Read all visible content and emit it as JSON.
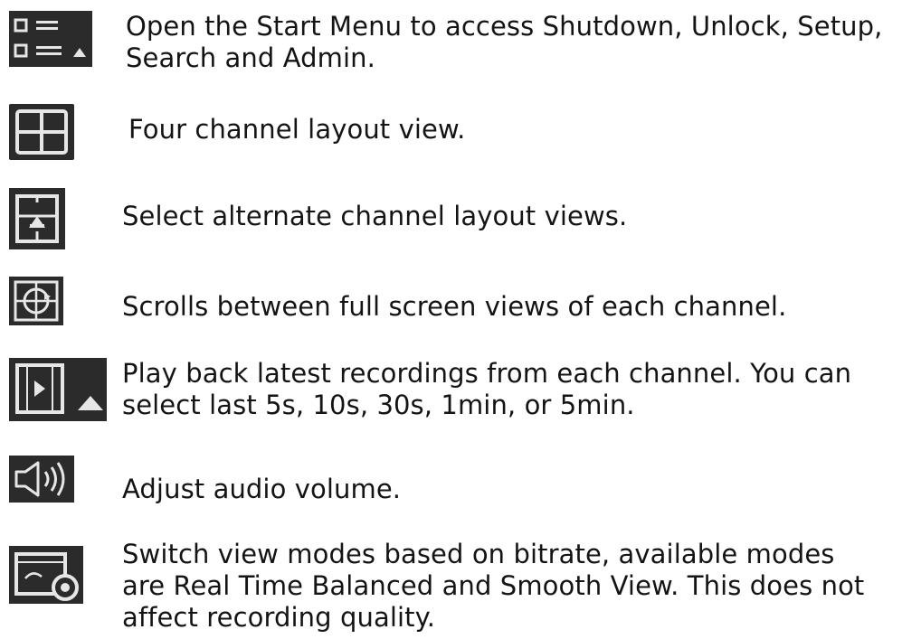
{
  "legend": {
    "items": [
      {
        "icon": "start-menu-icon",
        "text": "Open the Start Menu to access Shutdown, Unlock, Setup,\nSearch and Admin."
      },
      {
        "icon": "four-channel-layout-icon",
        "text": "Four channel layout view."
      },
      {
        "icon": "alternate-layout-icon",
        "text": "Select alternate channel layout views."
      },
      {
        "icon": "sequence-view-icon",
        "text": "Scrolls between full screen views of each channel."
      },
      {
        "icon": "playback-icon",
        "text": "Play back latest recordings from each channel. You can\nselect last 5s, 10s, 30s, 1min, or 5min."
      },
      {
        "icon": "audio-volume-icon",
        "text": "Adjust audio volume."
      },
      {
        "icon": "view-mode-icon",
        "text": "Switch view modes based on bitrate, available modes\nare Real Time Balanced and Smooth View. This does not\naffect recording quality."
      }
    ]
  },
  "colors": {
    "icon_background": "#2b2b2b",
    "icon_foreground": "#e6e6e6",
    "text": "#141414"
  }
}
